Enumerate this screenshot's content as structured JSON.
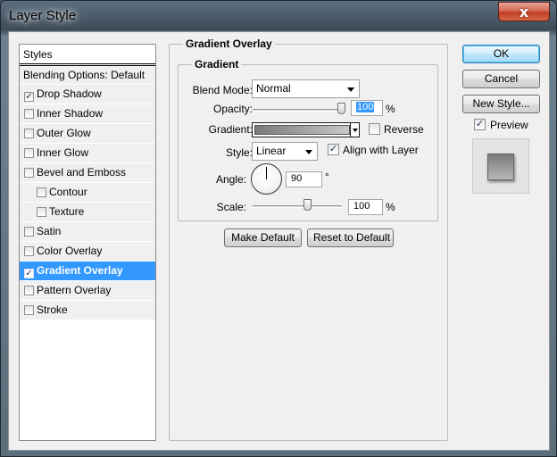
{
  "window": {
    "title": "Layer Style",
    "close_glyph": "x",
    "close_icon": "close-icon"
  },
  "styles_panel": {
    "header": "Styles",
    "items": [
      {
        "label": "Blending Options: Default",
        "checkbox": false,
        "checked": false,
        "indent": false,
        "selected": false
      },
      {
        "label": "Drop Shadow",
        "checkbox": true,
        "checked": true,
        "indent": false,
        "selected": false
      },
      {
        "label": "Inner Shadow",
        "checkbox": true,
        "checked": false,
        "indent": false,
        "selected": false
      },
      {
        "label": "Outer Glow",
        "checkbox": true,
        "checked": false,
        "indent": false,
        "selected": false
      },
      {
        "label": "Inner Glow",
        "checkbox": true,
        "checked": false,
        "indent": false,
        "selected": false
      },
      {
        "label": "Bevel and Emboss",
        "checkbox": true,
        "checked": false,
        "indent": false,
        "selected": false
      },
      {
        "label": "Contour",
        "checkbox": true,
        "checked": false,
        "indent": true,
        "selected": false
      },
      {
        "label": "Texture",
        "checkbox": true,
        "checked": false,
        "indent": true,
        "selected": false
      },
      {
        "label": "Satin",
        "checkbox": true,
        "checked": false,
        "indent": false,
        "selected": false
      },
      {
        "label": "Color Overlay",
        "checkbox": true,
        "checked": false,
        "indent": false,
        "selected": false
      },
      {
        "label": "Gradient Overlay",
        "checkbox": true,
        "checked": true,
        "indent": false,
        "selected": true
      },
      {
        "label": "Pattern Overlay",
        "checkbox": true,
        "checked": false,
        "indent": false,
        "selected": false
      },
      {
        "label": "Stroke",
        "checkbox": true,
        "checked": false,
        "indent": false,
        "selected": false
      }
    ]
  },
  "gradient_overlay": {
    "section_title": "Gradient Overlay",
    "group_title": "Gradient",
    "blend_mode_label": "Blend Mode:",
    "blend_mode_value": "Normal",
    "opacity_label": "Opacity:",
    "opacity_value": "100",
    "opacity_unit": "%",
    "opacity_fraction": 1.0,
    "gradient_label": "Gradient:",
    "gradient_colors": [
      "#7a7a7a",
      "#c8c8c8"
    ],
    "reverse_label": "Reverse",
    "reverse_checked": false,
    "style_label": "Style:",
    "style_value": "Linear",
    "align_label": "Align with Layer",
    "align_checked": true,
    "angle_label": "Angle:",
    "angle_value": "90",
    "angle_unit": "°",
    "scale_label": "Scale:",
    "scale_value": "100",
    "scale_unit": "%",
    "scale_fraction": 0.6,
    "make_default_label": "Make Default",
    "reset_default_label": "Reset to Default"
  },
  "actions": {
    "ok_label": "OK",
    "cancel_label": "Cancel",
    "new_style_label": "New Style...",
    "preview_label": "Preview",
    "preview_checked": true
  },
  "colors": {
    "selection": "#3399ff",
    "close_button": "#c03d23",
    "dialog_bg": "#f0f0f0"
  }
}
